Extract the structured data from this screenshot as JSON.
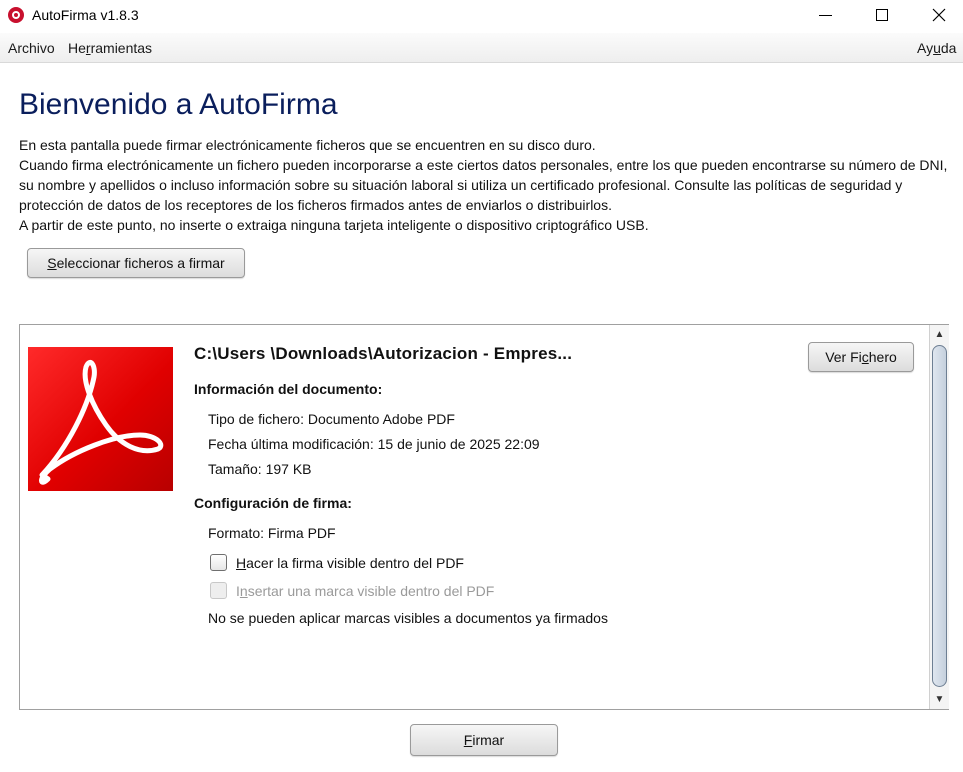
{
  "window": {
    "title": "AutoFirma v1.8.3"
  },
  "menu": {
    "archivo": "Archivo",
    "herramientas_pre": "He",
    "herramientas_u": "r",
    "herramientas_post": "ramientas",
    "ayuda_pre": "Ay",
    "ayuda_u": "u",
    "ayuda_post": "da"
  },
  "main": {
    "title": "Bienvenido a AutoFirma",
    "desc_line1": "En esta pantalla puede firmar electrónicamente ficheros que se encuentren en su disco duro.",
    "desc_para2": "Cuando firma electrónicamente un fichero pueden incorporarse a este ciertos datos personales, entre los que pueden encontrarse su número de DNI, su nombre y apellidos o incluso información sobre su situación laboral si utiliza un certificado profesional. Consulte las políticas de seguridad y protección de datos de los receptores de los ficheros firmados antes de enviarlos o distribuirlos.",
    "desc_line3": "A partir de este punto, no inserte o extraiga ninguna tarjeta inteligente o dispositivo criptográfico USB.",
    "select_button_u": "S",
    "select_button_rest": "eleccionar ficheros a firmar"
  },
  "file": {
    "icon": "pdf-icon",
    "name": "C:\\Users \\Downloads\\Autorizacion - Empres...",
    "view_button_pre": "Ver Fi",
    "view_button_u": "c",
    "view_button_post": "hero",
    "doc_info_heading": "Información del documento:",
    "file_type": "Tipo de fichero: Documento Adobe PDF",
    "last_modified": "Fecha última modificación: 15 de junio de 2025 22:09",
    "size": "Tamaño: 197 KB",
    "sign_config_heading": "Configuración de firma:",
    "format": "Formato: Firma PDF",
    "visible_signature_u": "H",
    "visible_signature_rest": "acer la firma visible dentro del PDF",
    "visible_signature_checked": false,
    "visible_mark_pre": "I",
    "visible_mark_u": "n",
    "visible_mark_post": "sertar una marca visible dentro del PDF",
    "visible_mark_enabled": false,
    "note": "No se pueden aplicar marcas visibles a documentos ya firmados"
  },
  "footer": {
    "sign_button_u": "F",
    "sign_button_rest": "irmar"
  },
  "colors": {
    "title": "#0a1e5c",
    "pdf_red": "#e00000",
    "disabled_text": "#9a9a9a"
  }
}
